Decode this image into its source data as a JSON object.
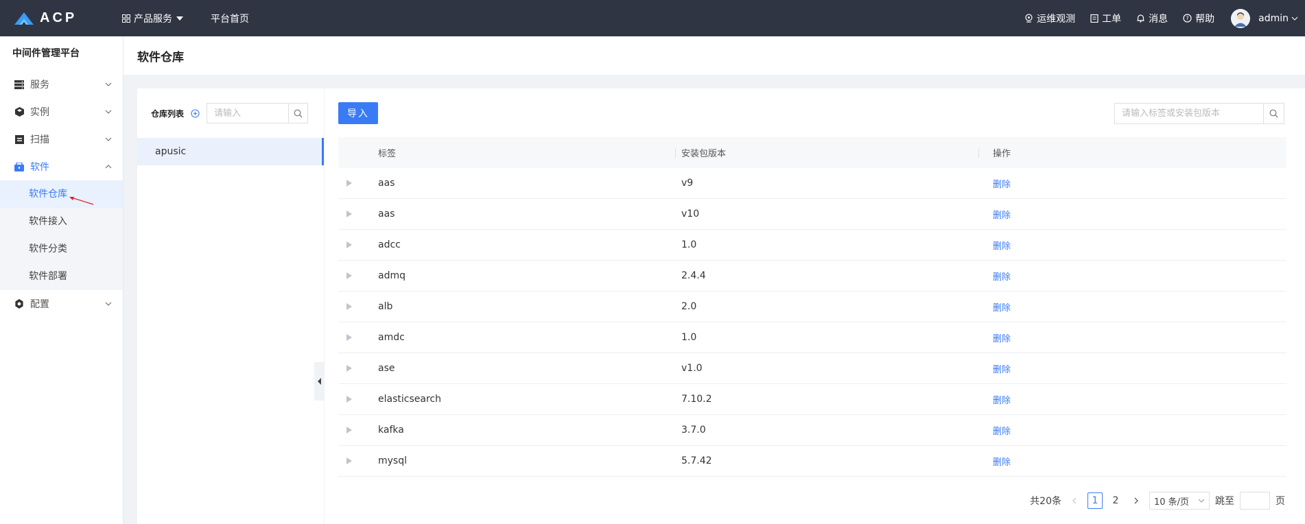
{
  "topbar": {
    "logo_text": "ACP",
    "nav": [
      {
        "label": "产品服务",
        "icon": "grid-icon",
        "has_dropdown": true
      },
      {
        "label": "平台首页"
      }
    ],
    "right": [
      {
        "label": "运维观测",
        "icon": "location-pin-icon"
      },
      {
        "label": "工单",
        "icon": "clipboard-icon"
      },
      {
        "label": "消息",
        "icon": "bell-icon"
      },
      {
        "label": "帮助",
        "icon": "help-circle-icon"
      }
    ],
    "user": "admin"
  },
  "sidebar": {
    "platform_title": "中间件管理平台",
    "menus": [
      {
        "label": "服务",
        "icon": "server-icon",
        "expanded": false
      },
      {
        "label": "实例",
        "icon": "cube-icon",
        "expanded": false
      },
      {
        "label": "扫描",
        "icon": "scan-icon",
        "expanded": false
      },
      {
        "label": "软件",
        "icon": "package-icon",
        "expanded": true,
        "children": [
          "软件仓库",
          "软件接入",
          "软件分类",
          "软件部署"
        ],
        "active_child": "软件仓库"
      },
      {
        "label": "配置",
        "icon": "gear-icon",
        "expanded": false
      }
    ]
  },
  "page": {
    "title": "软件仓库"
  },
  "repo_panel": {
    "title": "仓库列表",
    "search_placeholder": "请输入",
    "repos": [
      "apusic"
    ],
    "selected": "apusic"
  },
  "main": {
    "import_label": "导入",
    "search_placeholder": "请输入标签或安装包版本",
    "columns": [
      "标签",
      "安装包版本",
      "操作"
    ],
    "rows": [
      {
        "tag": "aas",
        "version": "v9",
        "action": "删除"
      },
      {
        "tag": "aas",
        "version": "v10",
        "action": "删除"
      },
      {
        "tag": "adcc",
        "version": "1.0",
        "action": "删除"
      },
      {
        "tag": "admq",
        "version": "2.4.4",
        "action": "删除"
      },
      {
        "tag": "alb",
        "version": "2.0",
        "action": "删除"
      },
      {
        "tag": "amdc",
        "version": "1.0",
        "action": "删除"
      },
      {
        "tag": "ase",
        "version": "v1.0",
        "action": "删除"
      },
      {
        "tag": "elasticsearch",
        "version": "7.10.2",
        "action": "删除"
      },
      {
        "tag": "kafka",
        "version": "3.7.0",
        "action": "删除"
      },
      {
        "tag": "mysql",
        "version": "5.7.42",
        "action": "删除"
      }
    ],
    "pagination": {
      "total": "共20条",
      "pages": [
        "1",
        "2"
      ],
      "current": "1",
      "page_size": "10 条/页",
      "jump_label": "跳至",
      "page_unit": "页"
    }
  },
  "colors": {
    "topbar_bg": "#2f3542",
    "accent": "#3a7bf5",
    "annotation_arrow": "#e02020"
  }
}
